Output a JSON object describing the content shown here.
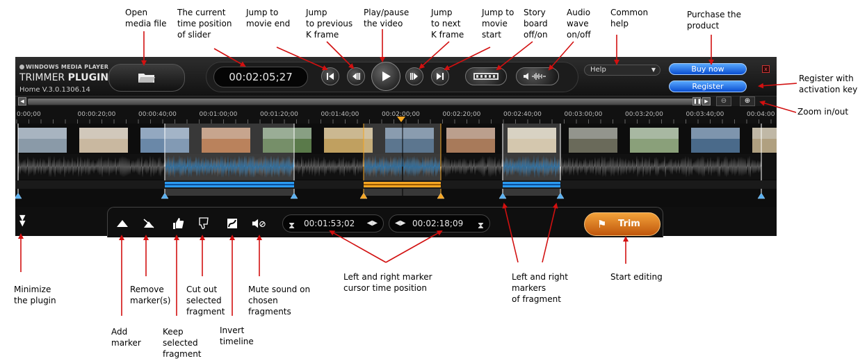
{
  "annotations": {
    "open": "Open\nmedia file",
    "current_time": "The current\ntime position\nof slider",
    "jump_end": "Jump to\nmovie end",
    "prev_k": "Jump\nto previous\nK frame",
    "play": "Play/pause\nthe video",
    "next_k": "Jump\nto next\nK frame",
    "jump_start": "Jump to\nmovie\nstart",
    "storyboard": "Story\nboard\noff/on",
    "audio_wave": "Audio\nwave\non/off",
    "help": "Common\nhelp",
    "purchase": "Purchase the\nproduct",
    "register": "Register with\nactivation key",
    "zoom": "Zoom in/out",
    "minimize": "Minimize\nthe plugin",
    "add_marker": "Add\nmarker",
    "remove_marker": "Remove\nmarker(s)",
    "keep": "Keep\nselected\nfragment",
    "cut": "Cut out\nselected\nfragment",
    "invert": "Invert\ntimeline",
    "mute": "Mute sound on\nchosen\nfragments",
    "marker_times": "Left and right marker\ncursor time position",
    "fragment_markers": "Left and right\nmarkers\nof fragment",
    "start_editing": "Start editing"
  },
  "player": {
    "brand_small": "WINDOWS MEDIA PLAYER",
    "brand_big_1": "TRIMMER ",
    "brand_big_2": "PLUGIN",
    "version": "Home V.3.0.1306.14",
    "current_time": "00:02:05;27",
    "help_label": "Help",
    "buy_label": "Buy now",
    "register_label": "Register",
    "close_label": "x",
    "left_marker_time": "00:01:53;02",
    "right_marker_time": "00:02:18;09",
    "trim_label": "Trim",
    "ruler_ticks": [
      "0:00;00",
      "00:00:20;00",
      "00:00:40;00",
      "00:01:00;00",
      "00:01:20;00",
      "00:01:40;00",
      "00:02:00;00",
      "00:02:20;00",
      "00:02:40;00",
      "00:03:00;00",
      "00:03:20;00",
      "00:03:40;00",
      "00:04:00"
    ]
  },
  "colors": {
    "selection_blue": "#2b9bf0",
    "selection_orange": "#f5a623",
    "waveform_gray": "#9a9a9a",
    "buy_blue": "#1a6ee8",
    "trim_orange": "#e37a1e"
  }
}
